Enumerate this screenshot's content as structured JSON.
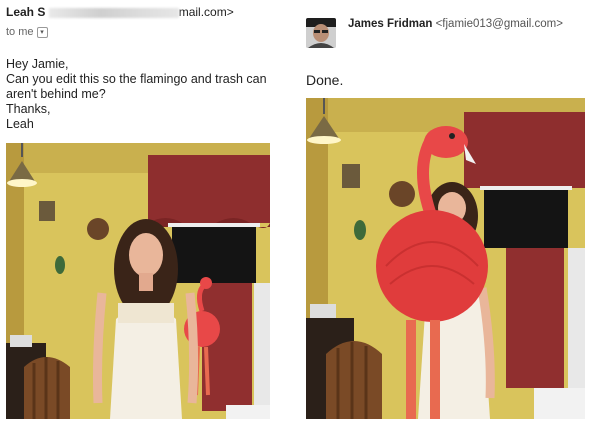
{
  "original_email": {
    "sender_name": "Leah S",
    "sender_email_visible": "mail.com>",
    "to_label": "to me",
    "lines": [
      "Hey Jamie,",
      "Can you edit this so the flamingo and trash can",
      "aren't behind me?",
      "Thanks,",
      "Leah"
    ]
  },
  "reply": {
    "sender_name": "James Fridman",
    "sender_email": "<fjamie013@gmail.com>",
    "body": "Done."
  },
  "icons": {
    "to_dropdown": "chevron-down-icon",
    "avatar": "user-avatar"
  }
}
